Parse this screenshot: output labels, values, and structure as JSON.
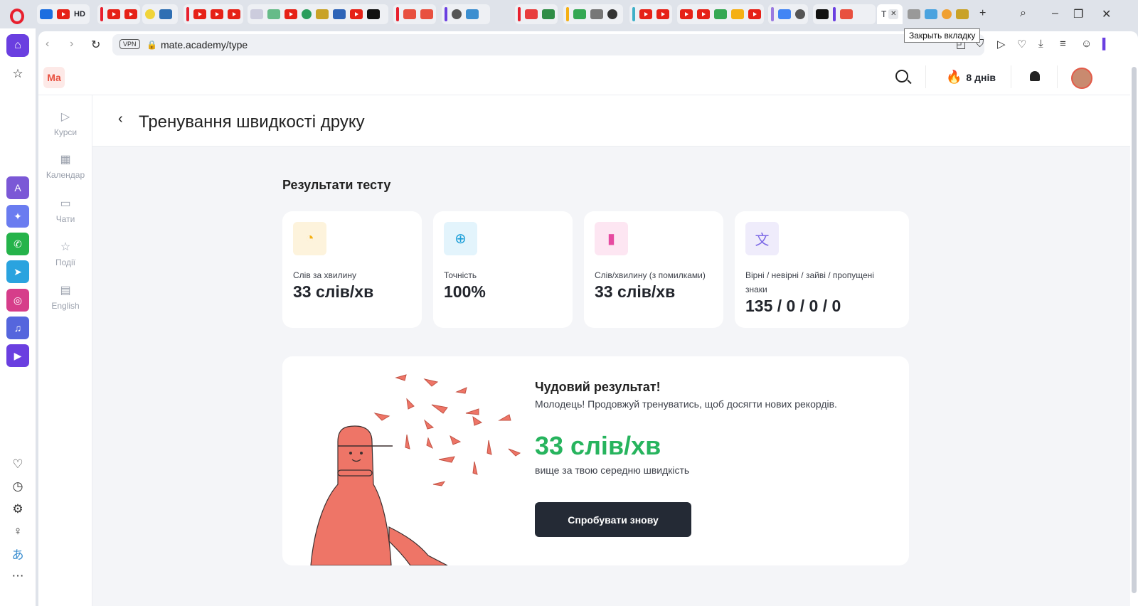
{
  "browser": {
    "url": "mate.academy/type",
    "vpn_label": "VPN",
    "tooltip": "Закрыть вкладку",
    "active_tab_prefix": "Т",
    "hd_label": "HD"
  },
  "app": {
    "logo_text": "Ма",
    "streak": "8 днів",
    "nav": [
      {
        "label": "Курси",
        "icon": "play-circle-icon"
      },
      {
        "label": "Календар",
        "icon": "calendar-icon"
      },
      {
        "label": "Чати",
        "icon": "chat-icon"
      },
      {
        "label": "Події",
        "icon": "star-icon"
      },
      {
        "label": "English",
        "icon": "english-icon"
      }
    ],
    "page_title": "Тренування швидкості друку"
  },
  "results": {
    "heading": "Результати тесту",
    "cards": [
      {
        "label": "Слів за хвилину",
        "value": "33 слів/хв",
        "icon": "speedometer-icon",
        "color": "#f5b014"
      },
      {
        "label": "Точність",
        "value": "100%",
        "icon": "target-icon",
        "color": "#1d9fd8"
      },
      {
        "label": "Слів/хвилину (з помилками)",
        "value": "33 слів/хв",
        "icon": "bar-chart-icon",
        "color": "#e64aa0"
      },
      {
        "label": "Вірні / невірні / зайві / пропущені знаки",
        "value": "135 / 0 / 0 / 0",
        "icon": "translate-icon",
        "color": "#7d6ae6"
      }
    ]
  },
  "summary": {
    "heading": "Чудовий результат!",
    "subtitle": "Молодець! Продовжуй тренуватись, щоб досягти нових рекордів.",
    "big_value": "33 слів/хв",
    "note": "вище за твою середню швидкість",
    "button": "Спробувати знову"
  },
  "colors": {
    "accent": "#27b45e",
    "brand": "#e8503f",
    "button": "#242a35"
  }
}
